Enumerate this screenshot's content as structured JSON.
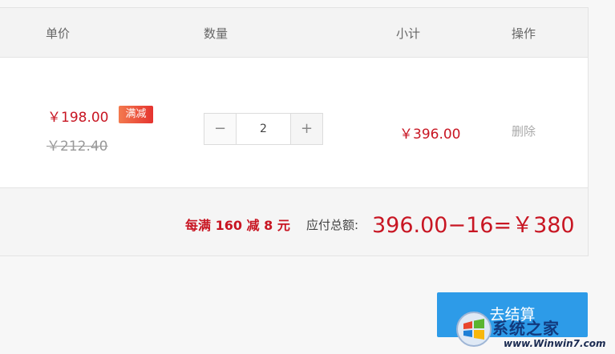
{
  "header": {
    "col_price": "单价",
    "col_quantity": "数量",
    "col_subtotal": "小计",
    "col_action": "操作"
  },
  "item": {
    "price_current": "￥198.00",
    "promo_badge": "满减",
    "price_original": "￥212.40",
    "qty_minus": "−",
    "quantity": "2",
    "qty_plus": "+",
    "subtotal": "￥396.00",
    "delete_label": "删除"
  },
  "summary": {
    "promo_rule": "每满 160 减 8 元",
    "total_label": "应付总额:",
    "total_amount": "396.00−16=￥380"
  },
  "checkout": {
    "label": "去结算"
  },
  "watermark": {
    "brand_cn": "系统之家",
    "url": "www.Winwin7.com"
  },
  "colors": {
    "accent_red": "#c81623",
    "button_blue": "#2d9be8"
  }
}
